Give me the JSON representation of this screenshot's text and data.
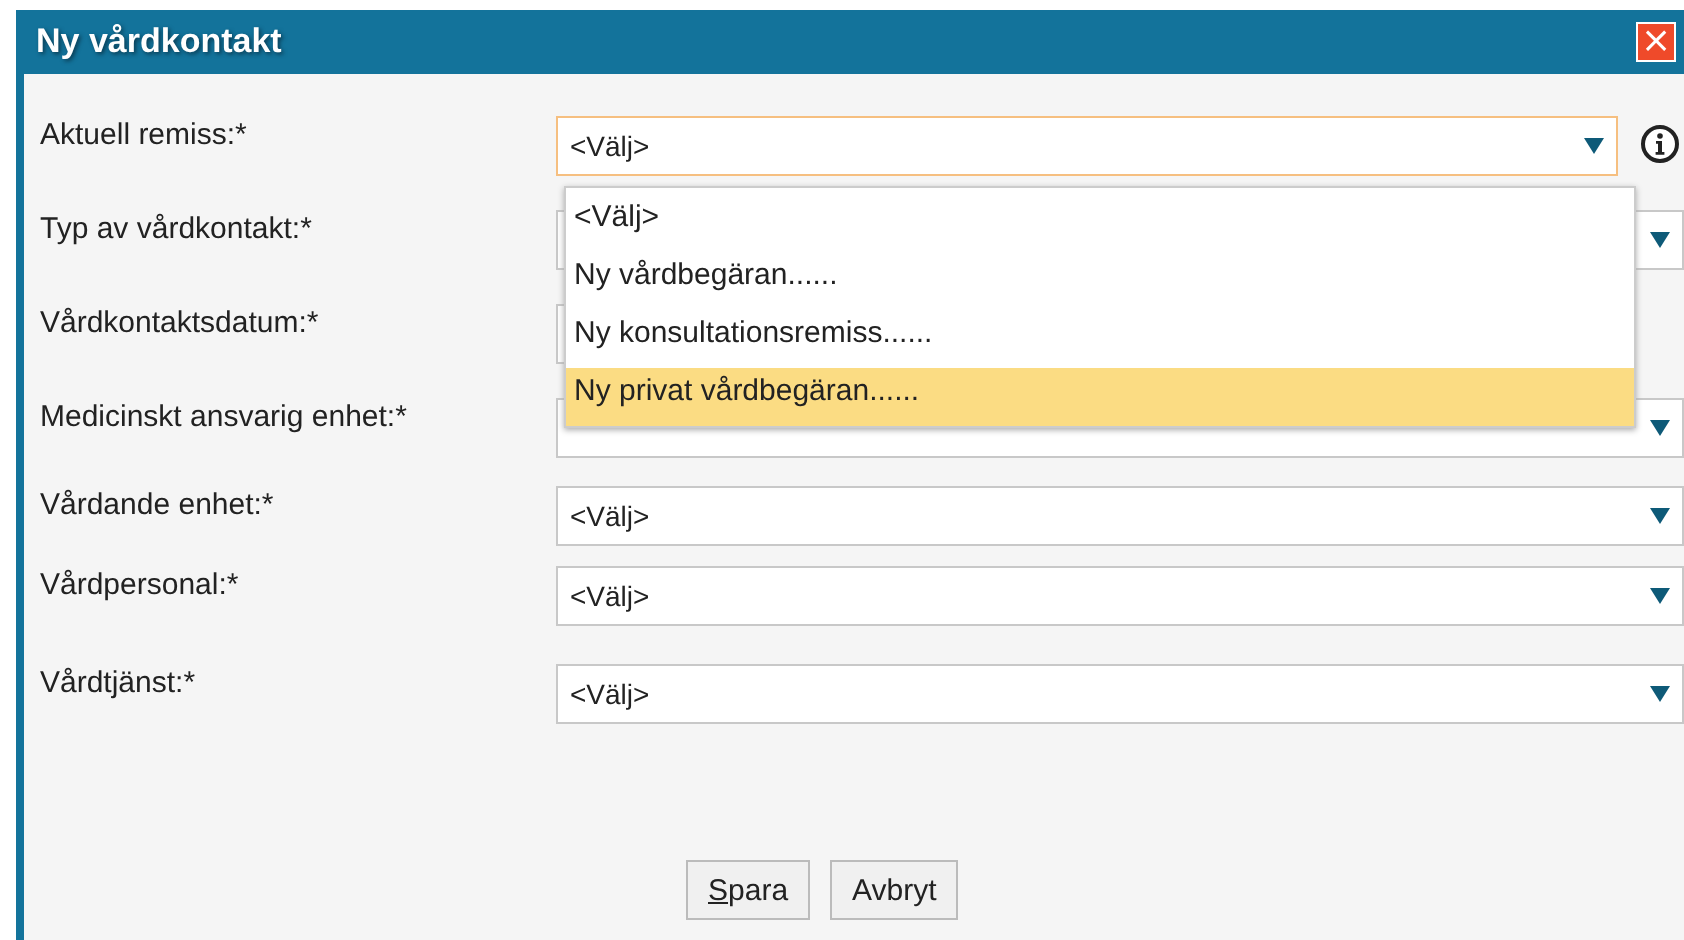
{
  "dialog": {
    "title": "Ny vårdkontakt",
    "close": "×"
  },
  "fields": [
    {
      "label": "Aktuell remiss:*",
      "kind": "select",
      "value": "<Välj>",
      "focused": true,
      "info": true
    },
    {
      "label": "Typ av vårdkontakt:*",
      "kind": "select",
      "focused": false,
      "info": false
    },
    {
      "label": "Vårdkontaktsdatum:*",
      "kind": "date",
      "focused": false,
      "info": false
    },
    {
      "label": "Medicinskt ansvarig enhet:*",
      "kind": "select",
      "focused": false,
      "info": false
    },
    {
      "label": "Vårdande enhet:*",
      "kind": "select",
      "value": "<Välj>",
      "focused": false,
      "info": false
    },
    {
      "label": "Vårdpersonal:*",
      "kind": "select",
      "value": "<Välj>",
      "focused": false,
      "info": false
    },
    {
      "label": "Vårdtjänst:*",
      "kind": "select",
      "value": "<Välj>",
      "focused": false,
      "info": false
    }
  ],
  "dropdown": {
    "options": [
      {
        "label": "<Välj>",
        "selected": false
      },
      {
        "label": "Ny vårdbegäran......",
        "selected": false
      },
      {
        "label": "Ny konsultationsremiss......",
        "selected": false
      },
      {
        "label": "Ny privat vårdbegäran......",
        "selected": true
      }
    ]
  },
  "buttons": [
    {
      "label": "Spara",
      "accesskey": true
    },
    {
      "label": "Avbryt",
      "accesskey": false
    }
  ]
}
